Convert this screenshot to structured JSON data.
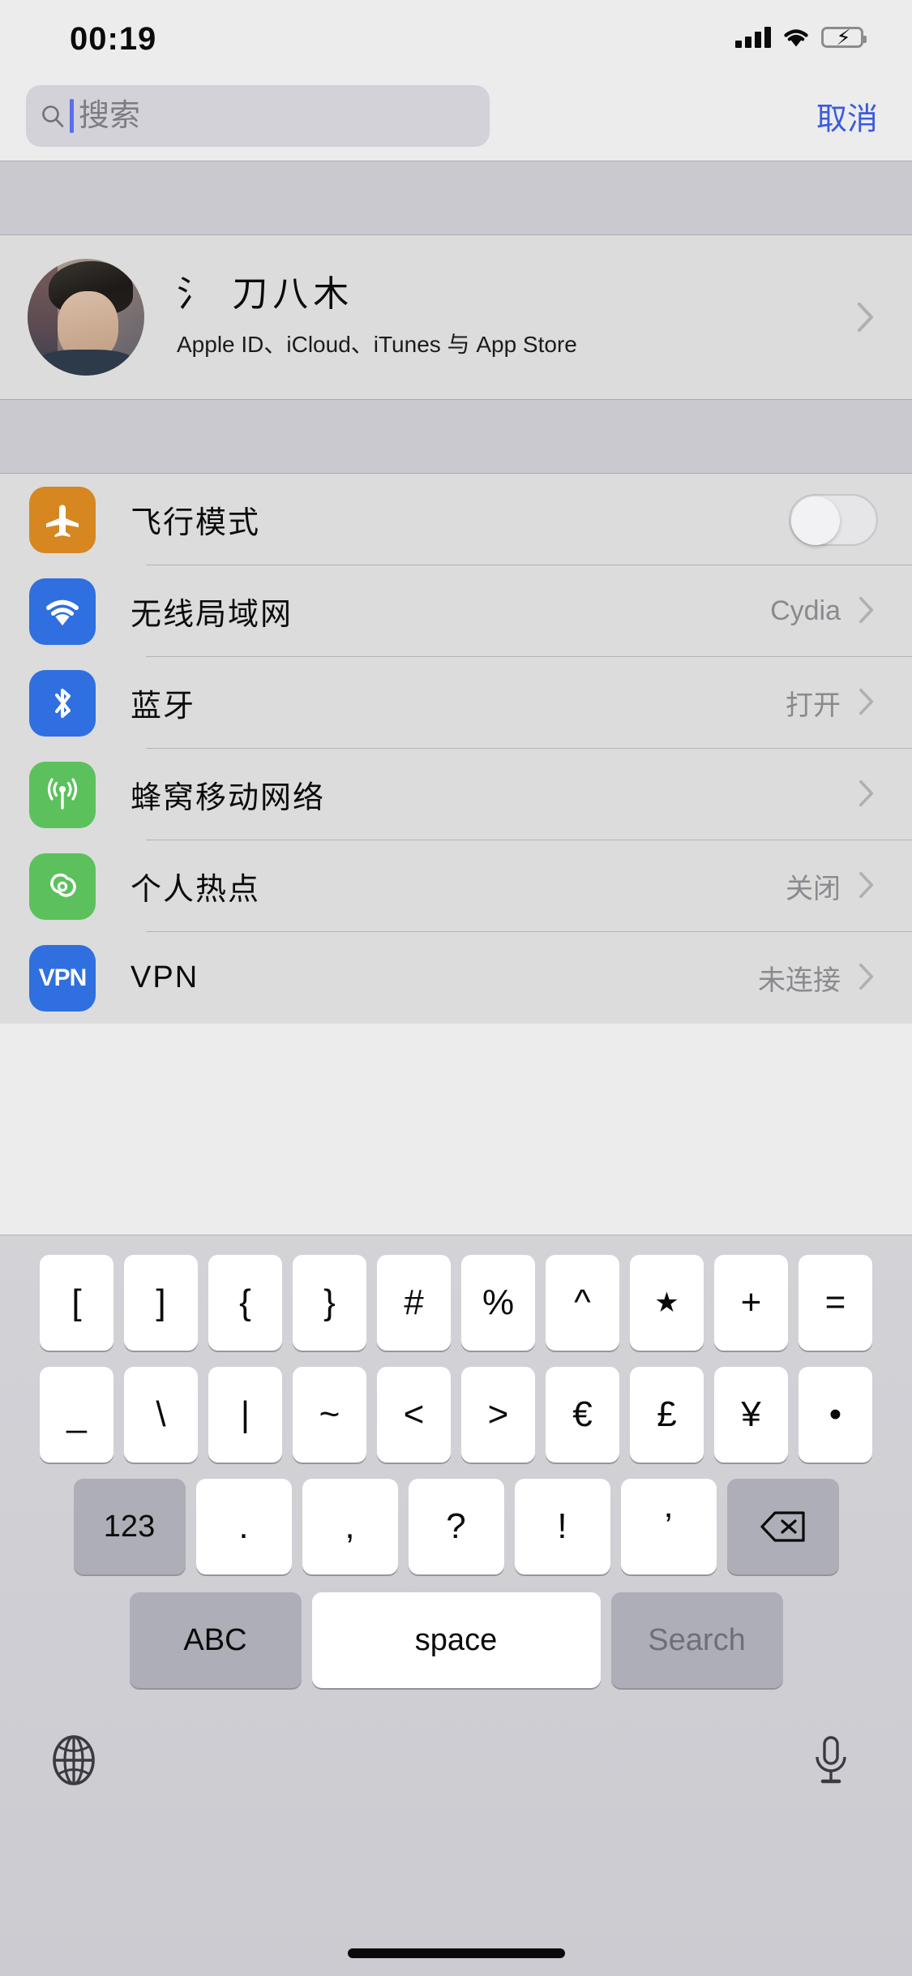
{
  "status_bar": {
    "time": "00:19",
    "signal_icon": "cellular-signal-icon",
    "wifi_icon": "wifi-icon",
    "battery_icon": "battery-charging-icon",
    "battery_color": "#4cd964"
  },
  "search": {
    "placeholder": "搜索",
    "value": "",
    "icon": "search-icon",
    "cancel_label": "取消",
    "cancel_color": "#3b5bdb"
  },
  "profile": {
    "name": "氵 刀八木",
    "subtitle": "Apple ID、iCloud、iTunes 与 App Store",
    "avatar": "user-avatar",
    "chevron": "chevron-right-icon"
  },
  "settings_rows": [
    {
      "label": "飞行模式",
      "icon": "airplane-icon",
      "icon_class": "ic-airplane",
      "icon_color": "#d6871f",
      "control": "toggle",
      "toggle_on": false,
      "value": ""
    },
    {
      "label": "无线局域网",
      "icon": "wifi-icon",
      "icon_class": "ic-wifi",
      "icon_color": "#2f6fe0",
      "control": "chevron",
      "value": "Cydia"
    },
    {
      "label": "蓝牙",
      "icon": "bluetooth-icon",
      "icon_class": "ic-bt",
      "icon_color": "#2f6fe0",
      "control": "chevron",
      "value": "打开"
    },
    {
      "label": "蜂窝移动网络",
      "icon": "cellular-icon",
      "icon_class": "ic-cell",
      "icon_color": "#5cc15c",
      "control": "chevron",
      "value": ""
    },
    {
      "label": "个人热点",
      "icon": "hotspot-icon",
      "icon_class": "ic-hotspot",
      "icon_color": "#5cc15c",
      "control": "chevron",
      "value": "关闭"
    },
    {
      "label": "VPN",
      "icon": "vpn-icon",
      "icon_class": "ic-vpn",
      "icon_color": "#2f6fe0",
      "icon_text": "VPN",
      "control": "chevron",
      "value": "未连接"
    }
  ],
  "keyboard": {
    "row1": [
      "[",
      "]",
      "{",
      "}",
      "#",
      "%",
      "^",
      "★",
      "+",
      "="
    ],
    "row2": [
      "_",
      "\\",
      "|",
      "~",
      "<",
      ">",
      "€",
      "£",
      "¥",
      "•"
    ],
    "row3_left_label": "123",
    "row3": [
      ".",
      ",",
      "?",
      "!",
      "’"
    ],
    "delete_icon": "delete-backward-icon",
    "abc_label": "ABC",
    "space_label": "space",
    "search_label": "Search",
    "globe_icon": "globe-icon",
    "mic_icon": "microphone-icon"
  }
}
